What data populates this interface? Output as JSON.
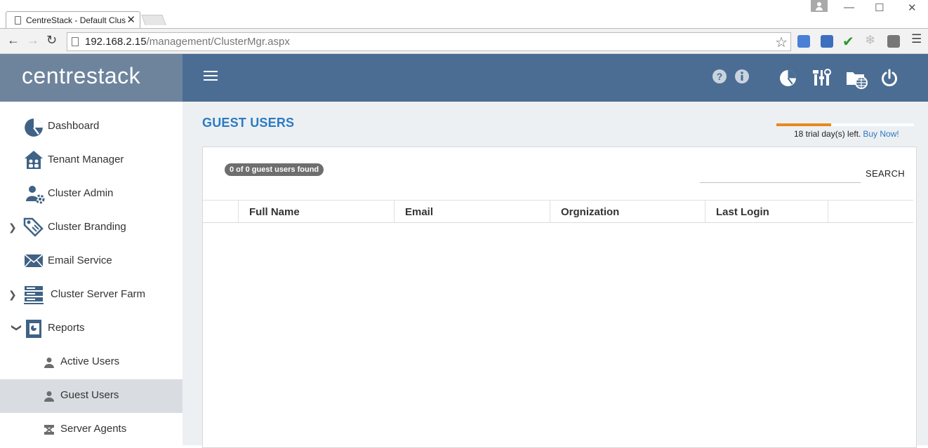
{
  "browser": {
    "tab_title": "CentreStack - Default Clus",
    "tab_close": "✕",
    "url_host": "192.168.2.15",
    "url_path": "/management/ClusterMgr.aspx",
    "window_controls": [
      "—",
      "☐",
      "✕"
    ]
  },
  "header": {
    "logo": "centrestack",
    "icons": [
      "help-icon",
      "info-icon",
      "dashboard-pie-icon",
      "settings-tools-icon",
      "web-folder-icon",
      "power-icon"
    ]
  },
  "sidebar": {
    "items": [
      {
        "label": "Dashboard",
        "icon": "dashboard-pie-icon"
      },
      {
        "label": "Tenant Manager",
        "icon": "tenant-house-icon"
      },
      {
        "label": "Cluster Admin",
        "icon": "admin-user-gear-icon"
      },
      {
        "label": "Cluster Branding",
        "icon": "branding-tag-icon",
        "expandable": true
      },
      {
        "label": "Email Service",
        "icon": "envelope-icon"
      },
      {
        "label": "Cluster Server Farm",
        "icon": "server-farm-icon",
        "expandable": true
      },
      {
        "label": "Reports",
        "icon": "reports-icon",
        "expanded": true
      },
      {
        "label": "Active Users",
        "icon": "user-icon"
      },
      {
        "label": "Guest Users",
        "icon": "user-icon",
        "active": true
      },
      {
        "label": "Server Agents",
        "icon": "server-agent-icon"
      }
    ]
  },
  "main": {
    "title": "GUEST USERS",
    "trial": {
      "text": "18 trial day(s) left.",
      "link": "Buy Now!",
      "progress": 0.4
    },
    "count_badge": "0 of 0 guest users found",
    "search_button": "SEARCH",
    "search_value": "",
    "columns": [
      "Full Name",
      "Email",
      "Orgnization",
      "Last Login"
    ]
  },
  "colors": {
    "header_bg": "#4b6d94",
    "logo_bg": "#6e849d",
    "accent_blue": "#2b7bc2",
    "trial_orange": "#e8891c",
    "sidebar_active": "#d9dde1"
  }
}
